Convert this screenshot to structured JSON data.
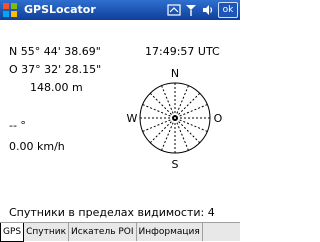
{
  "app": {
    "title": "GPSLocator"
  },
  "tray": {
    "ok_label": "ok"
  },
  "gps": {
    "latitude": "N 55° 44' 38.69\"",
    "longitude": "O 37° 32' 28.15\"",
    "altitude": "148.00 m",
    "time": "17:49:57 UTC",
    "heading": "-- °",
    "speed": "0.00 km/h",
    "satellites_text": "Спутники в пределах видимости: 4"
  },
  "compass": {
    "n": "N",
    "e": "O",
    "s": "S",
    "w": "W"
  },
  "tabs": [
    {
      "label": "GPS",
      "active": true
    },
    {
      "label": "Спутник"
    },
    {
      "label": "Искатель POI"
    },
    {
      "label": "Информация"
    }
  ]
}
